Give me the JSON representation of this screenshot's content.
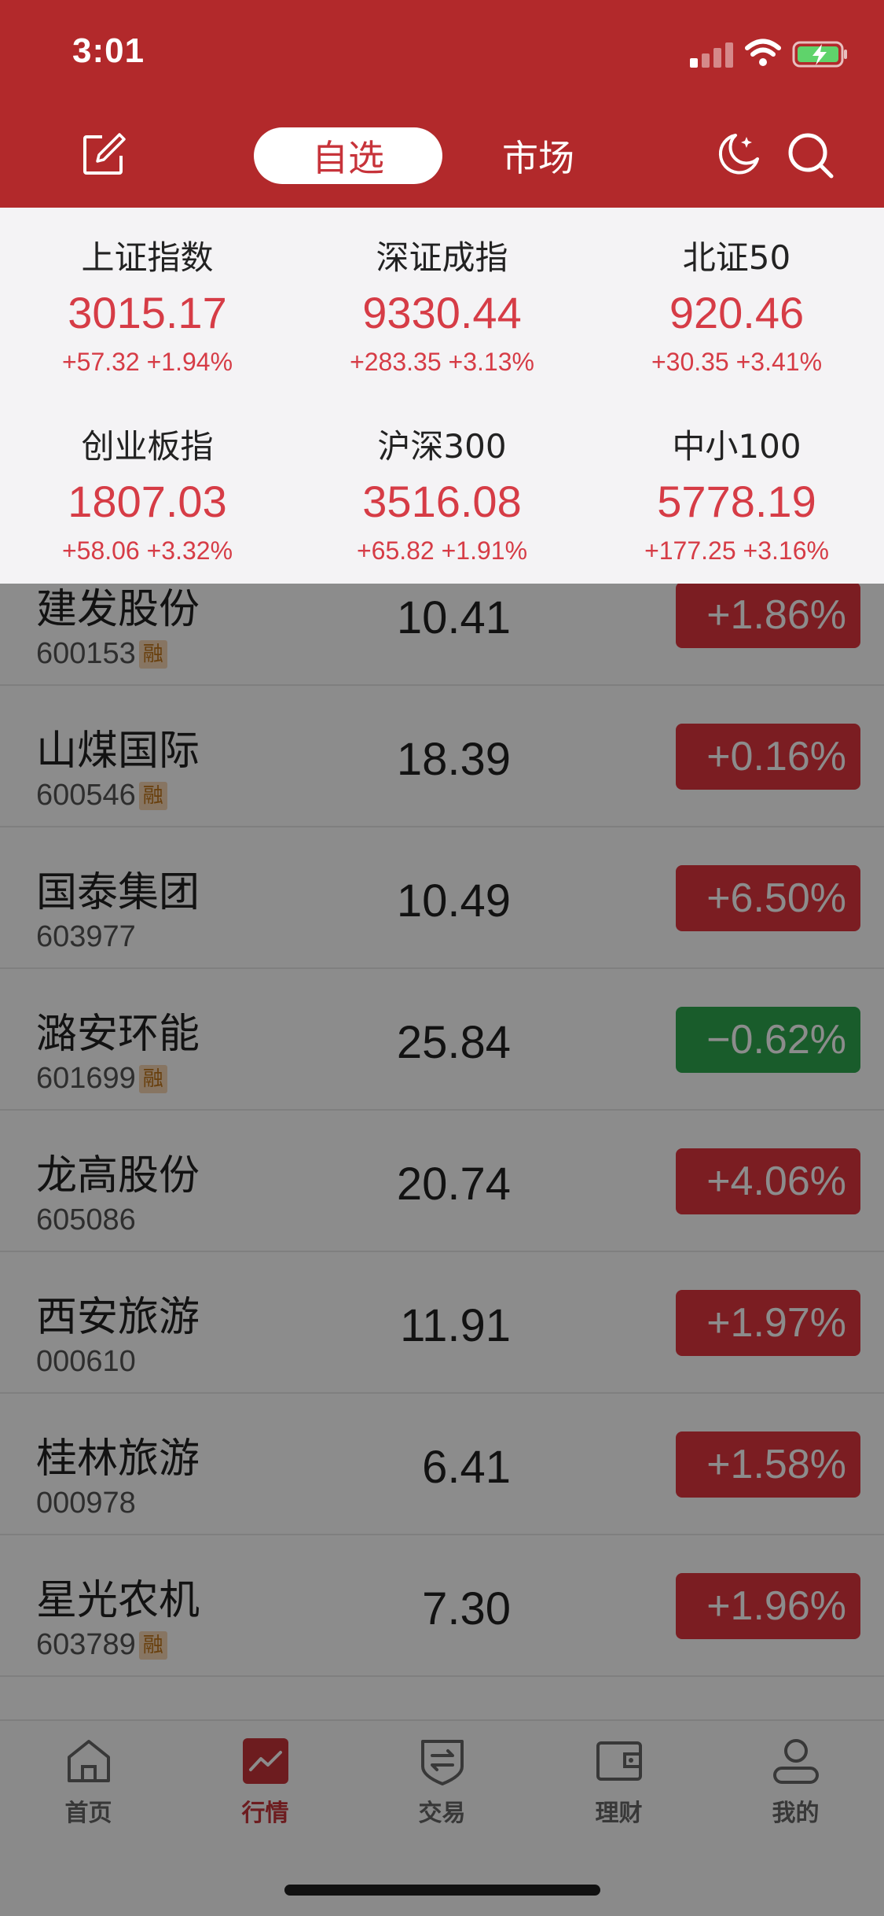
{
  "status_bar": {
    "time": "3:01"
  },
  "header": {
    "tabs": [
      {
        "label": "自选",
        "active": true
      },
      {
        "label": "市场",
        "active": false
      }
    ],
    "icons": [
      "edit-icon",
      "moon-icon",
      "search-icon"
    ],
    "accent_color": "#b2292b"
  },
  "indices": [
    {
      "name": "上证指数",
      "value": "3015.17",
      "change": "+57.32 +1.94%"
    },
    {
      "name": "深证成指",
      "value": "9330.44",
      "change": "+283.35 +3.13%"
    },
    {
      "name": "北证50",
      "value": "920.46",
      "change": "+30.35 +3.41%"
    },
    {
      "name": "创业板指",
      "value": "1807.03",
      "change": "+58.06 +3.32%"
    },
    {
      "name": "沪深300",
      "value": "3516.08",
      "change": "+65.82 +1.91%"
    },
    {
      "name": "中小100",
      "value": "5778.19",
      "change": "+177.25 +3.16%"
    }
  ],
  "stocks": [
    {
      "name": "建发股份",
      "code": "600153",
      "margin": "融",
      "price": "10.41",
      "pct": "+1.86%",
      "dir": "up"
    },
    {
      "name": "山煤国际",
      "code": "600546",
      "margin": "融",
      "price": "18.39",
      "pct": "+0.16%",
      "dir": "up"
    },
    {
      "name": "国泰集团",
      "code": "603977",
      "margin": "",
      "price": "10.49",
      "pct": "+6.50%",
      "dir": "up"
    },
    {
      "name": "潞安环能",
      "code": "601699",
      "margin": "融",
      "price": "25.84",
      "pct": "−0.62%",
      "dir": "down"
    },
    {
      "name": "龙高股份",
      "code": "605086",
      "margin": "",
      "price": "20.74",
      "pct": "+4.06%",
      "dir": "up"
    },
    {
      "name": "西安旅游",
      "code": "000610",
      "margin": "",
      "price": "11.91",
      "pct": "+1.97%",
      "dir": "up"
    },
    {
      "name": "桂林旅游",
      "code": "000978",
      "margin": "",
      "price": "6.41",
      "pct": "+1.58%",
      "dir": "up"
    },
    {
      "name": "星光农机",
      "code": "603789",
      "margin": "融",
      "price": "7.30",
      "pct": "+1.96%",
      "dir": "up"
    }
  ],
  "tabbar": [
    {
      "label": "首页",
      "icon": "home-icon",
      "active": false
    },
    {
      "label": "行情",
      "icon": "chart-icon",
      "active": true
    },
    {
      "label": "交易",
      "icon": "trade-icon",
      "active": false
    },
    {
      "label": "理财",
      "icon": "wallet-icon",
      "active": false
    },
    {
      "label": "我的",
      "icon": "profile-icon",
      "active": false
    }
  ],
  "colors": {
    "up": "#e0363f",
    "down": "#2fa84f",
    "index_red": "#d63c46"
  }
}
